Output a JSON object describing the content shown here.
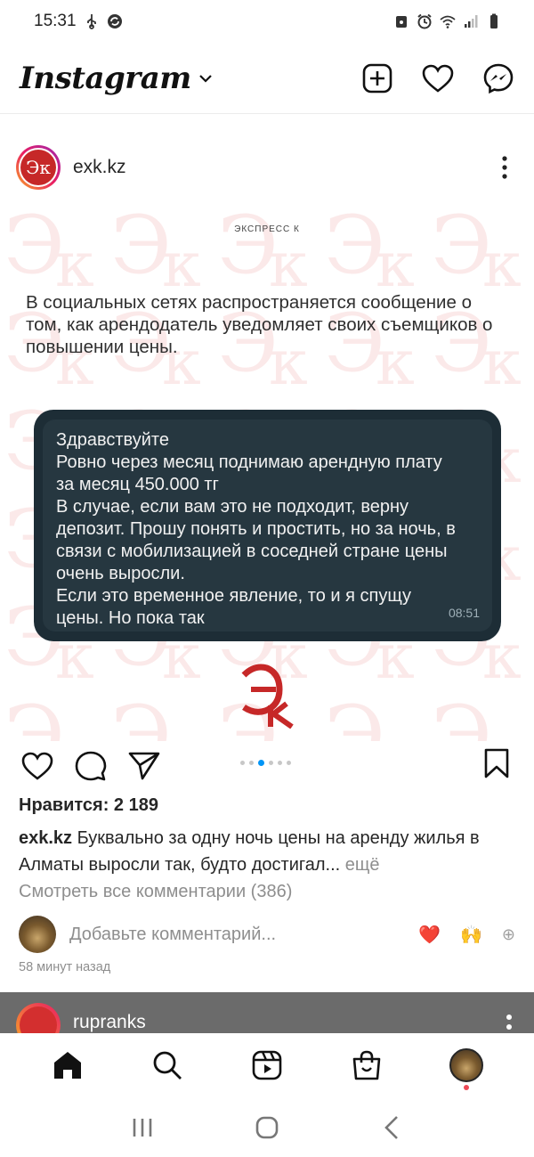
{
  "status_bar": {
    "time": "15:31",
    "left_icons": [
      "usb-icon",
      "sync-icon"
    ],
    "right_icons": [
      "nfc-icon",
      "alarm-icon",
      "wifi-icon",
      "signal-icon",
      "battery-icon"
    ]
  },
  "header": {
    "logo_text": "Instagram",
    "actions": [
      "new-post-icon",
      "heart-icon",
      "messenger-icon"
    ]
  },
  "post": {
    "username": "exk.kz",
    "avatar_text": "Эк",
    "image": {
      "brand_small": "ЭКСПРЕСС К",
      "intro_text": "В социальных сетях распространяется сообщение о том, как арендодатель уведомляет своих съемщиков о повышении цены.",
      "message_lines": [
        "Здравствуйте",
        "Ровно через месяц поднимаю арендную плату",
        "за месяц 450.000 тг",
        "В случае, если вам это не подходит, верну",
        "депозит. Прошу понять и простить, но за ночь, в",
        "связи с мобилизацией в соседней стране цены",
        "очень выросли.",
        "Если это временное явление, то и я спущу",
        "цены. Но пока так"
      ],
      "message_time": "08:51",
      "brand_logo_text": "Эк",
      "carousel_count": 6,
      "carousel_active": 3
    },
    "likes": "Нравится: 2 189",
    "caption_user": "exk.kz",
    "caption_text": " Буквально за одну ночь цены на аренду жилья в Алматы выросли так, будто достигал...",
    "caption_more": " ещё",
    "view_comments": "Смотреть все комментарии (386)",
    "add_comment_placeholder": "Добавьте комментарий...",
    "quick_emojis": [
      "❤️",
      "🙌",
      "⊕"
    ],
    "time_ago": "58 минут назад"
  },
  "next_post": {
    "username": "rupranks"
  },
  "bottom_nav": [
    "home-icon",
    "search-icon",
    "reels-icon",
    "shop-icon",
    "profile-avatar"
  ],
  "system_nav": [
    "recent-apps-icon",
    "home-button-icon",
    "back-icon"
  ],
  "colors": {
    "accent_blue": "#0095f6",
    "brand_red": "#c62828",
    "notification_red": "#ed4956",
    "message_bg": "#263740"
  }
}
